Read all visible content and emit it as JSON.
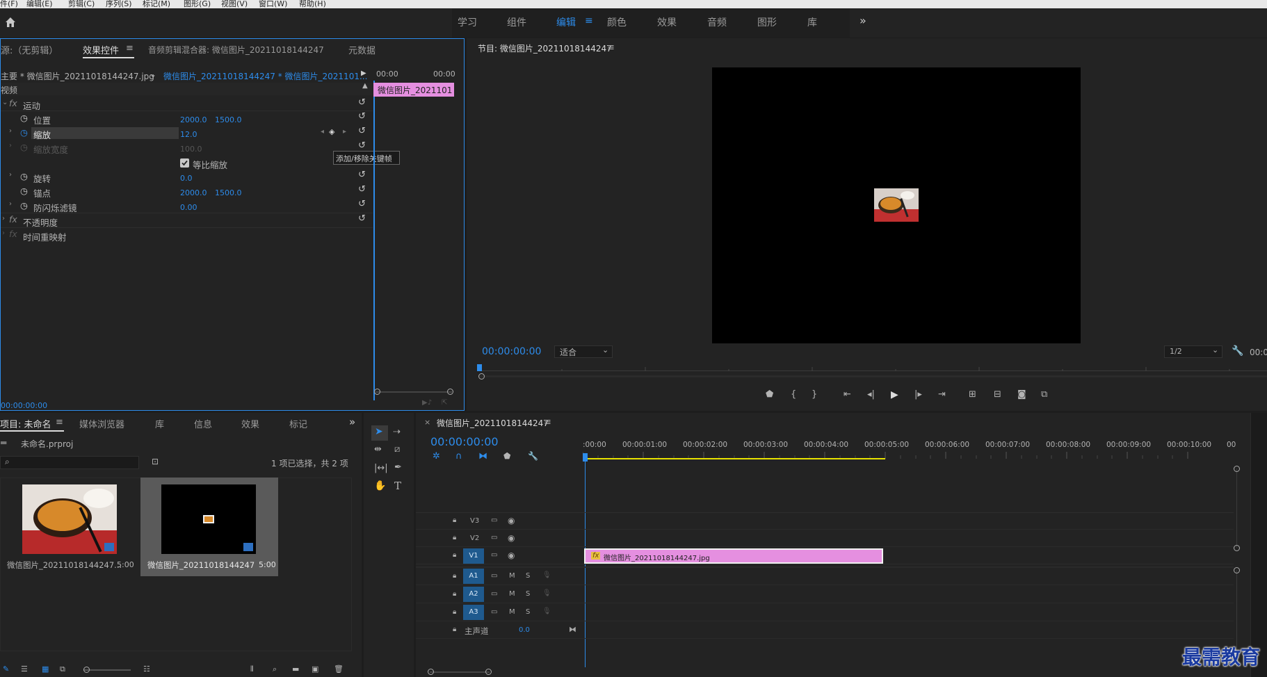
{
  "menu": [
    "件(F)",
    "编辑(E)",
    "剪辑(C)",
    "序列(S)",
    "标记(M)",
    "图形(G)",
    "视图(V)",
    "窗口(W)",
    "帮助(H)"
  ],
  "workspaces": [
    "学习",
    "组件",
    "编辑",
    "颜色",
    "效果",
    "音频",
    "图形",
    "库"
  ],
  "active_workspace": "编辑",
  "effects_panel": {
    "tabs": [
      "源:（无剪辑）",
      "效果控件",
      "音频剪辑混合器: 微信图片_20211018144247",
      "元数据"
    ],
    "active_tab": "效果控件",
    "master_clip": "主要 * 微信图片_20211018144247.jpg",
    "sequence_clip": "微信图片_20211018144247 * 微信图片_2021101...",
    "mini_times": [
      "00:00",
      "00:00"
    ],
    "mini_clip": "微信图片_2021101",
    "section_video": "视频",
    "motion": "运动",
    "position": {
      "label": "位置",
      "x": "2000.0",
      "y": "1500.0"
    },
    "scale": {
      "label": "缩放",
      "value": "12.0"
    },
    "scale_width": {
      "label": "缩放宽度",
      "value": "100.0"
    },
    "uniform_scale": "等比缩放",
    "rotation": {
      "label": "旋转",
      "value": "0.0"
    },
    "anchor": {
      "label": "锚点",
      "x": "2000.0",
      "y": "1500.0"
    },
    "antiflicker": {
      "label": "防闪烁滤镜",
      "value": "0.00"
    },
    "opacity": "不透明度",
    "time_remap": "时间重映射",
    "tooltip": "添加/移除关键帧",
    "footer_time": "00:00:00:00"
  },
  "program": {
    "title": "节目: 微信图片_20211018144247",
    "timecode": "00:00:00:00",
    "fit": "适合",
    "resolution": "1/2",
    "right_timecode": "00:0"
  },
  "project": {
    "tabs": [
      "项目: 未命名",
      "媒体浏览器",
      "库",
      "信息",
      "效果",
      "标记"
    ],
    "active_tab": "项目: 未命名",
    "file": "未命名.prproj",
    "selection": "1 项已选择，共 2 项",
    "items": [
      {
        "name": "微信图片_20211018144247...",
        "duration": "5:00"
      },
      {
        "name": "微信图片_20211018144247",
        "duration": "5:00"
      }
    ]
  },
  "timeline": {
    "title": "微信图片_20211018144247",
    "timecode": "00:00:00:00",
    "ruler": [
      ":00:00",
      "00:00:01:00",
      "00:00:02:00",
      "00:00:03:00",
      "00:00:04:00",
      "00:00:05:00",
      "00:00:06:00",
      "00:00:07:00",
      "00:00:08:00",
      "00:00:09:00",
      "00:00:10:00",
      "00"
    ],
    "video_tracks": [
      "V3",
      "V2",
      "V1"
    ],
    "audio_tracks": [
      "A1",
      "A2",
      "A3"
    ],
    "mute": "M",
    "solo": "S",
    "master": "主声道",
    "master_value": "0.0",
    "clip_name": "微信图片_20211018144247.jpg",
    "clip_fx": "fx"
  },
  "watermark": "最需教育",
  "colors": {
    "accent": "#2d8ceb",
    "clip": "#e58fe0",
    "panel": "#232323",
    "bg": "#1d1d1d"
  }
}
